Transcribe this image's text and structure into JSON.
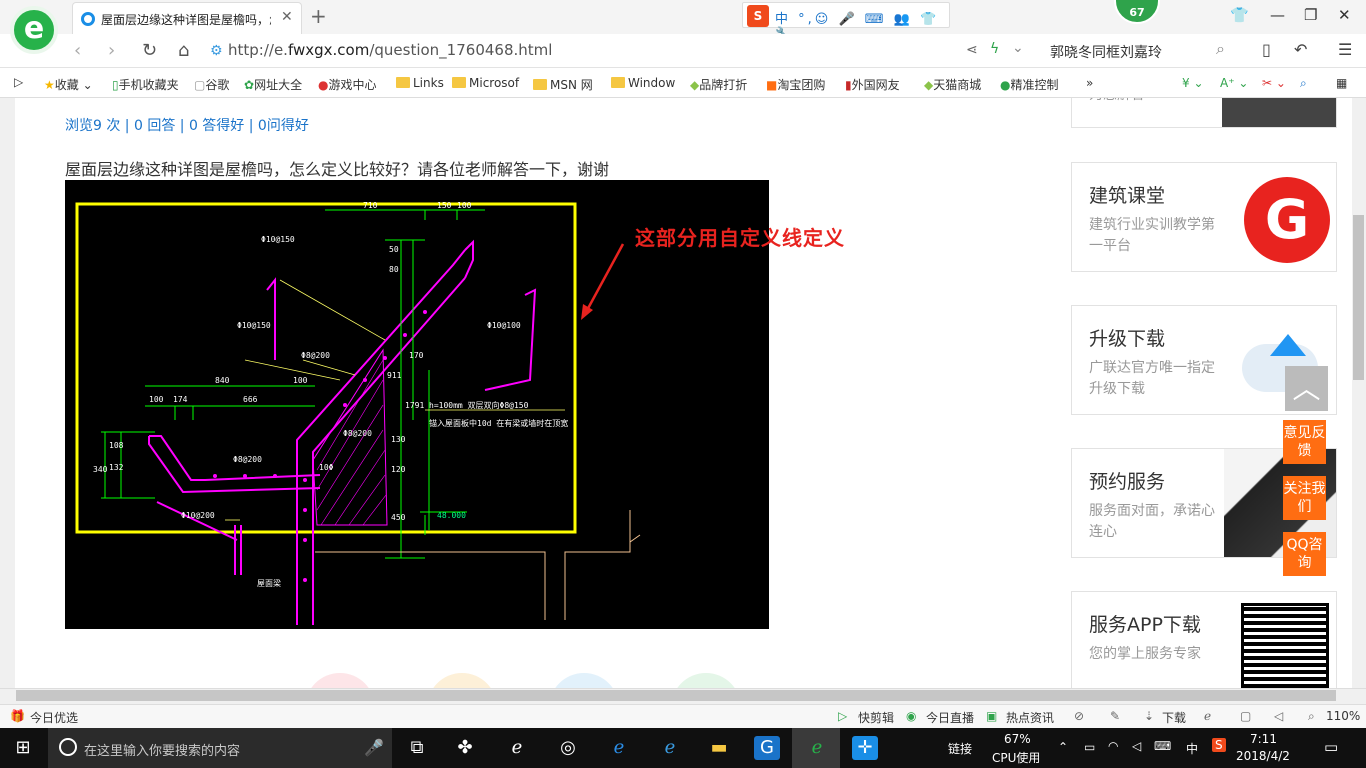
{
  "browser": {
    "tab_title": "屋面层边缘这种详图是屋檐吗，怎么定义",
    "tab_close": "✕",
    "new_tab": "+",
    "sogou_label": "S",
    "sogou_rest": "中 °,☺ 🎤 ⌨ 👥 👕 🔧",
    "badge_count": "67",
    "url_prefix": "http://e.",
    "url_domain": "fwxgx.com",
    "url_path": "/question_1760468.html",
    "search_text": "郭晓冬同框刘嘉玲",
    "bookmarks": [
      "收藏",
      "手机收藏夹",
      "谷歌",
      "网址大全",
      "游戏中心",
      "Links",
      "Microsof",
      "MSN 网",
      "Window",
      "品牌打折",
      "淘宝团购",
      "外国网友",
      "天猫商城",
      "精准控制"
    ]
  },
  "question": {
    "stats": "浏览9 次 | 0 回答 | 0 答得好 | 0问得好",
    "text": "屋面层边缘这种详图是屋檐吗，怎么定义比较好？请各位老师解答一下，谢谢"
  },
  "drawing": {
    "annotation": "这部分用自定义线定义",
    "dims": {
      "d710": "710",
      "d150": "150",
      "d100": "100",
      "d840": "840",
      "d100b": "100",
      "d666": "666",
      "d174": "174",
      "d100c": "100",
      "d340": "340",
      "d132": "132",
      "d108": "108",
      "d1791": "1791",
      "d911": "911",
      "d50": "50",
      "d80": "80",
      "d130": "130",
      "d120": "120",
      "d450": "450",
      "d170": "170"
    },
    "rebar_labels": {
      "r1": "Φ10@150",
      "r2": "Φ10@150",
      "r3": "Φ8@200",
      "r4": "Φ10@100",
      "r5": "Φ8@200",
      "r6": "Φ8@200",
      "r7": "Φ10@200",
      "r8": "10Φ"
    },
    "note1": "h=100mm  双层双向Φ8@150",
    "note2": "锚入屋面板中10d    在有梁或墙时在顶宽",
    "elevation": "48.000",
    "beam_label": "屋面梁"
  },
  "sidebar": {
    "cards": [
      {
        "title": "",
        "subtitle": "为您解答"
      },
      {
        "title": "建筑课堂",
        "subtitle": "建筑行业实训教学第一平台"
      },
      {
        "title": "升级下载",
        "subtitle": "广联达官方唯一指定升级下载"
      },
      {
        "title": "预约服务",
        "subtitle": "服务面对面，承诺心连心"
      },
      {
        "title": "服务APP下载",
        "subtitle": "您的掌上服务专家"
      }
    ],
    "feedback": "意见反馈",
    "follow": "关注我们",
    "qq": "QQ咨询",
    "scroll_top": "︿"
  },
  "statusbar": {
    "today": "今日优选",
    "kuaijian": "快剪辑",
    "live": "今日直播",
    "news": "热点资讯",
    "download": "下载",
    "zoom": "110%"
  },
  "taskbar": {
    "search_placeholder": "在这里输入你要搜索的内容",
    "link": "链接",
    "cpu": "67%",
    "cpu_label": "CPU使用",
    "ime": "中",
    "time": "7:11",
    "date": "2018/4/2"
  },
  "colors": {
    "link_blue": "#1a73c9",
    "annotation_red": "#e8231f",
    "orange": "#ff6d12",
    "cad_yellow": "#ffff00",
    "cad_green": "#00ff00",
    "cad_magenta": "#ff00ff"
  }
}
